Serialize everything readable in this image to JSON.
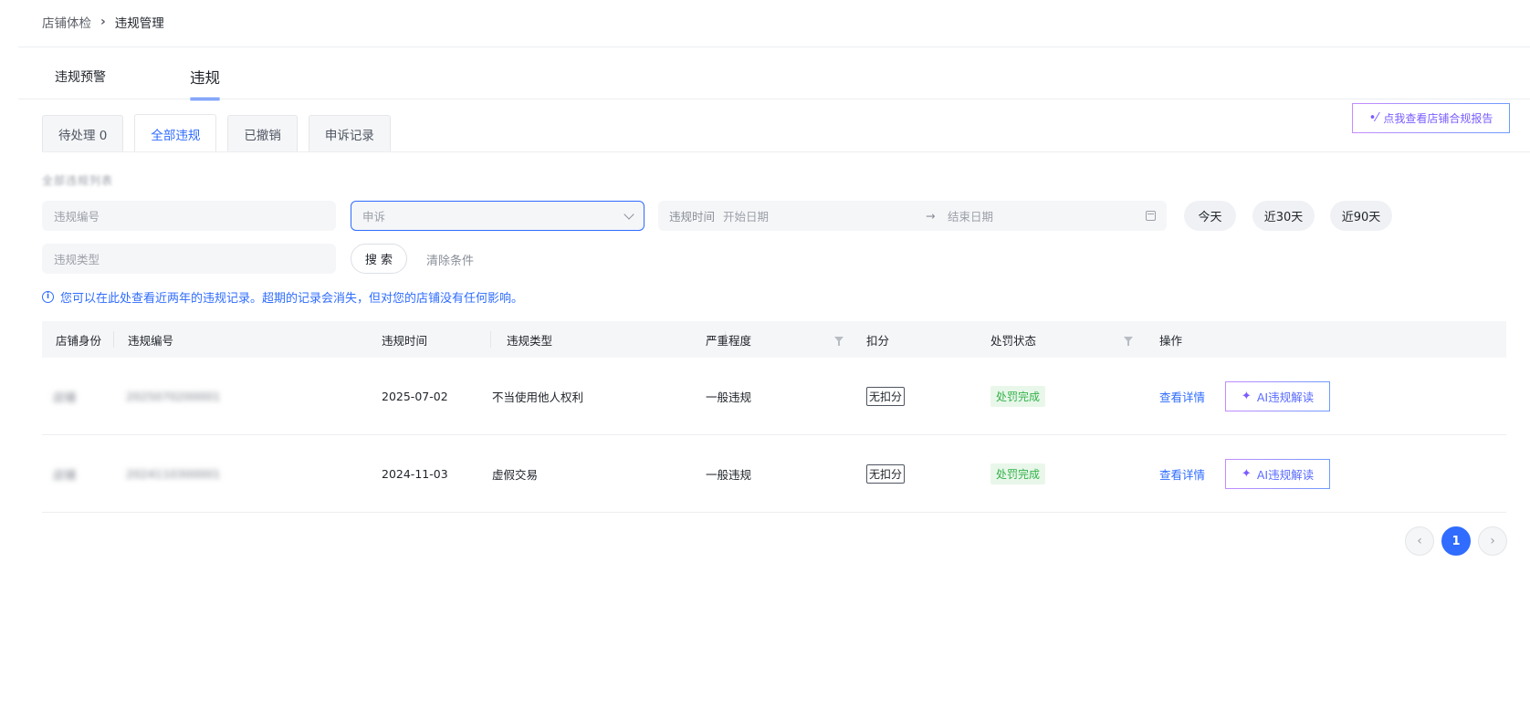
{
  "breadcrumb": {
    "parent": "店铺体检",
    "separator": "›",
    "current": "违规管理"
  },
  "main_tabs": [
    {
      "label": "违规预警",
      "active": false
    },
    {
      "label": "违规",
      "active": true
    }
  ],
  "report_button": {
    "label": "点我查看店铺合规报告",
    "icon": "magic-wand-icon"
  },
  "sub_tabs": [
    {
      "label": "待处理 0",
      "active": false
    },
    {
      "label": "全部违规",
      "active": true
    },
    {
      "label": "已撤销",
      "active": false
    },
    {
      "label": "申诉记录",
      "active": false
    }
  ],
  "section_title": "全部违规列表",
  "filters": {
    "violation_no_placeholder": "违规编号",
    "appeal_select_value": "申诉",
    "date_label": "违规时间",
    "start_placeholder": "开始日期",
    "arrow": "→",
    "end_placeholder": "结束日期",
    "violation_type_placeholder": "违规类型",
    "quick_ranges": [
      "今天",
      "近30天",
      "近90天"
    ],
    "search_label": "搜 索",
    "clear_label": "清除条件"
  },
  "notice": {
    "icon": "info-icon",
    "text": "您可以在此处查看近两年的违规记录。超期的记录会消失，但对您的店铺没有任何影响。"
  },
  "table": {
    "columns": [
      "店铺身份",
      "违规编号",
      "违规时间",
      "违规类型",
      "严重程度",
      "扣分",
      "处罚状态",
      "操作"
    ],
    "rows": [
      {
        "identity": "店铺",
        "violation_no": "2025070200001",
        "time": "2025-07-02",
        "type": "不当使用他人权利",
        "severity": "一般违规",
        "points": "无扣分",
        "status": "处罚完成",
        "detail_link": "查看详情",
        "ai_button": "AI违规解读"
      },
      {
        "identity": "店铺",
        "violation_no": "2024110300001",
        "time": "2024-11-03",
        "type": "虚假交易",
        "severity": "一般违规",
        "points": "无扣分",
        "status": "处罚完成",
        "detail_link": "查看详情",
        "ai_button": "AI违规解读"
      }
    ]
  },
  "pagination": {
    "prev": "‹",
    "current": "1",
    "next": "›"
  },
  "colors": {
    "accent": "#2f6cff",
    "success": "#33b24a",
    "ai_gradient_start": "#c58cff",
    "ai_gradient_end": "#6e9bff"
  }
}
